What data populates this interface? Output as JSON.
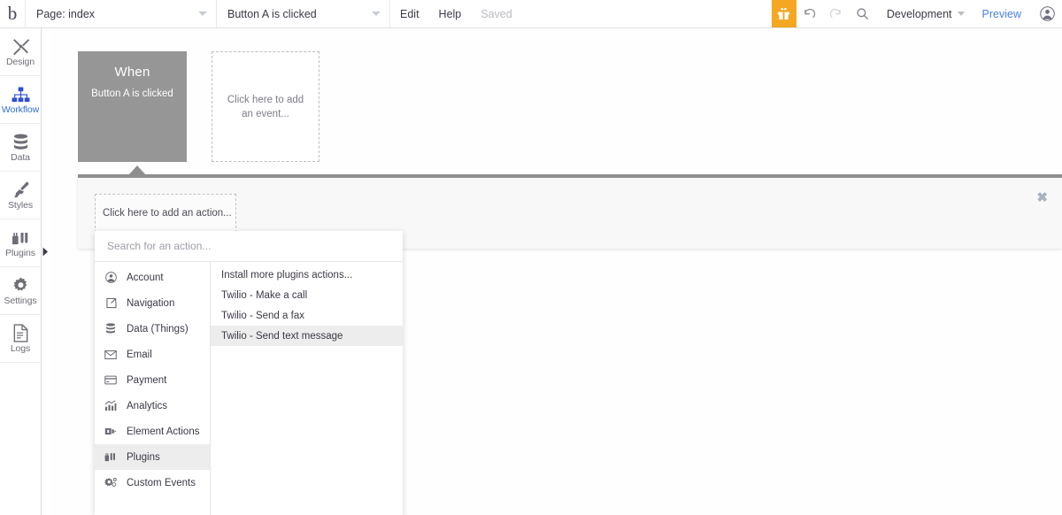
{
  "topbar": {
    "logo": "b",
    "page_selector": {
      "label": "Page: index",
      "icon": "chevron-down-icon"
    },
    "event_selector": {
      "label": "Button A is clicked",
      "icon": "chevron-down-icon"
    },
    "edit_label": "Edit",
    "help_label": "Help",
    "saved_label": "Saved",
    "gift_icon": "gift-icon",
    "undo_icon": "undo-icon",
    "redo_icon": "redo-icon",
    "search_icon": "search-icon",
    "environment": {
      "label": "Development",
      "icon": "chevron-down-icon"
    },
    "preview_label": "Preview",
    "avatar_icon": "user-avatar-icon"
  },
  "sidebar": {
    "items": [
      {
        "label": "Design",
        "icon": "design-tools-icon",
        "active": false
      },
      {
        "label": "Workflow",
        "icon": "workflow-tree-icon",
        "active": true
      },
      {
        "label": "Data",
        "icon": "database-icon",
        "active": false
      },
      {
        "label": "Styles",
        "icon": "paintbrush-icon",
        "active": false
      },
      {
        "label": "Plugins",
        "icon": "plugins-icon",
        "active": false
      },
      {
        "label": "Settings",
        "icon": "gear-icon",
        "active": false
      },
      {
        "label": "Logs",
        "icon": "document-icon",
        "active": false
      }
    ],
    "expand_icon": "expand-right-icon"
  },
  "canvas": {
    "when_block": {
      "title": "When",
      "subtitle": "Button A is clicked"
    },
    "add_event_placeholder": "Click here to add an event..."
  },
  "action_panel": {
    "add_action_placeholder": "Click here to add an action...",
    "close_icon": "close-icon",
    "close_glyph": "✖"
  },
  "dropdown": {
    "search_placeholder": "Search for an action...",
    "search_value": "",
    "categories": [
      {
        "label": "Account",
        "icon": "account-icon",
        "selected": false
      },
      {
        "label": "Navigation",
        "icon": "navigation-icon",
        "selected": false
      },
      {
        "label": "Data (Things)",
        "icon": "database-icon",
        "selected": false
      },
      {
        "label": "Email",
        "icon": "email-icon",
        "selected": false
      },
      {
        "label": "Payment",
        "icon": "credit-card-icon",
        "selected": false
      },
      {
        "label": "Analytics",
        "icon": "analytics-chart-icon",
        "selected": false
      },
      {
        "label": "Element Actions",
        "icon": "element-actions-icon",
        "selected": false
      },
      {
        "label": "Plugins",
        "icon": "plugins-icon",
        "selected": true
      },
      {
        "label": "Custom Events",
        "icon": "custom-events-icon",
        "selected": false
      }
    ],
    "items": [
      {
        "label": "Install more plugins actions...",
        "selected": false
      },
      {
        "label": "Twilio - Make a call",
        "selected": false
      },
      {
        "label": "Twilio - Send a fax",
        "selected": false
      },
      {
        "label": "Twilio - Send text message",
        "selected": true
      }
    ]
  },
  "colors": {
    "accent_orange": "#f5a623",
    "active_blue": "#2f6fd0",
    "link_blue": "#4a7fe0",
    "when_block_grey": "#969696",
    "panel_border_grey": "#8e8e8e"
  }
}
